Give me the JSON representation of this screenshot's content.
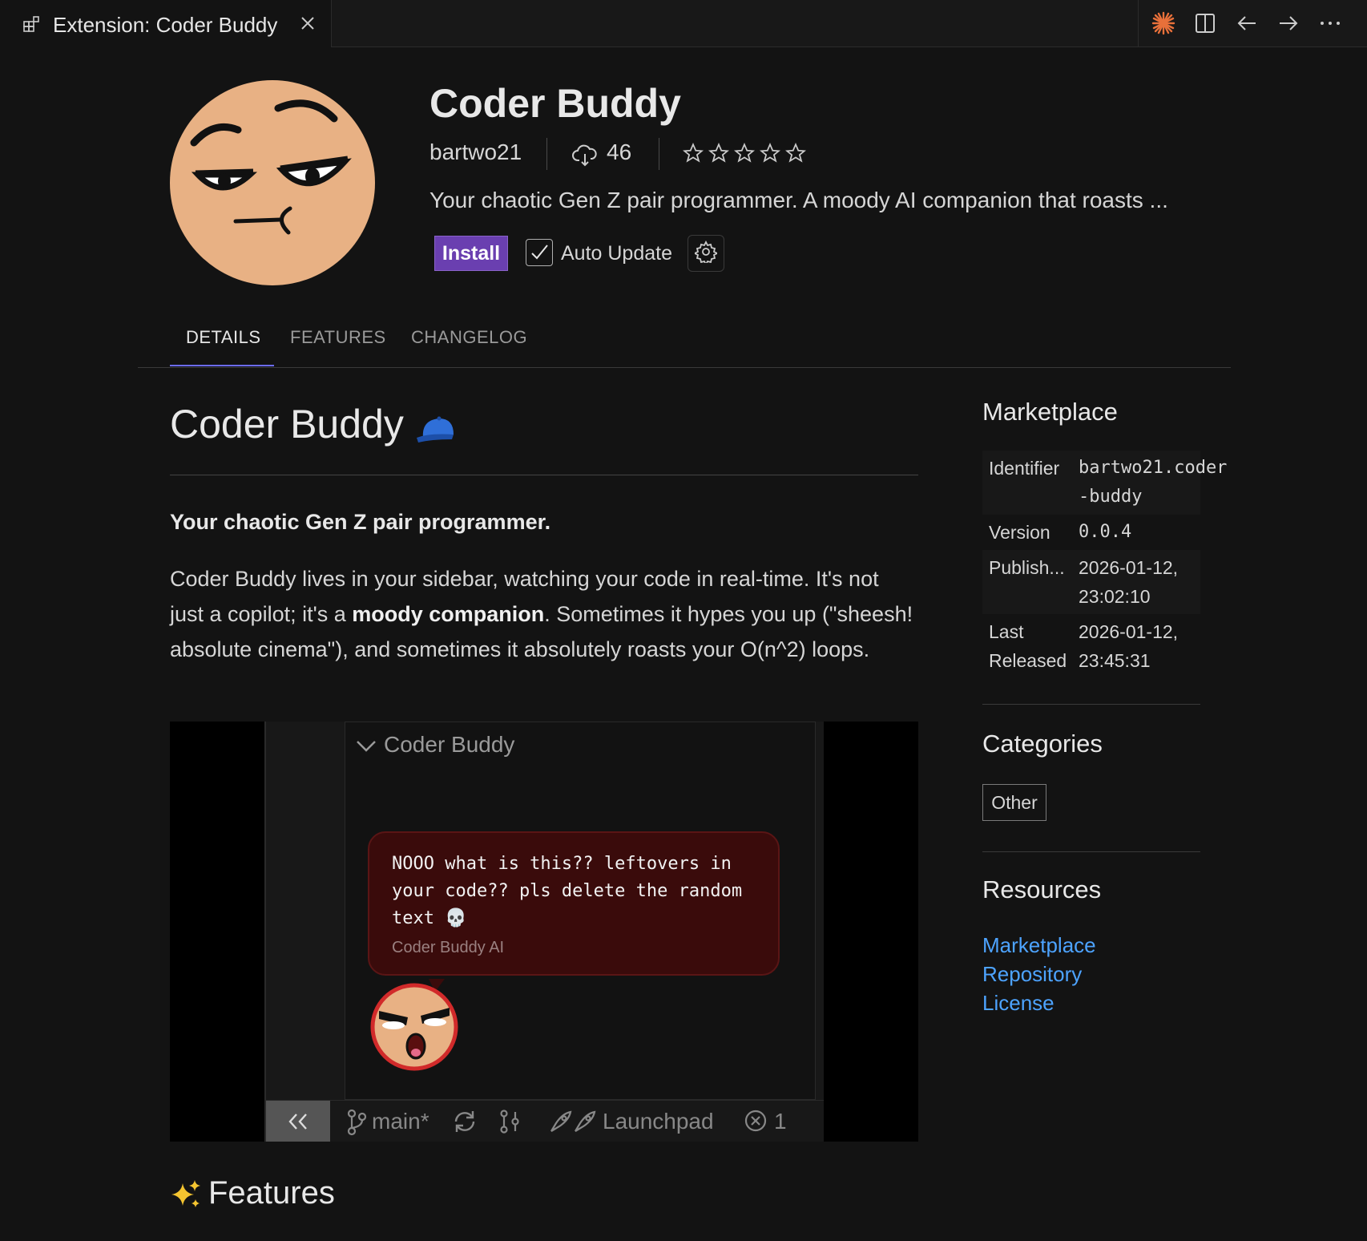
{
  "tab": {
    "title": "Extension: Coder Buddy",
    "icon": "extensions-icon"
  },
  "editor_actions": [
    "copilot-icon",
    "split-editor-icon",
    "go-back-icon",
    "go-forward-icon",
    "more-actions-icon"
  ],
  "header": {
    "name": "Coder Buddy",
    "publisher": "bartwo21",
    "downloads": "46",
    "rating_stars": 0,
    "short_description": "Your chaotic Gen Z pair programmer. A moody AI companion that roasts ...",
    "install_label": "Install",
    "auto_update_label": "Auto Update",
    "auto_update_checked": true
  },
  "nav_tabs": [
    {
      "label": "DETAILS",
      "active": true
    },
    {
      "label": "FEATURES",
      "active": false
    },
    {
      "label": "CHANGELOG",
      "active": false
    }
  ],
  "readme": {
    "heading": "Coder Buddy",
    "tagline": "Your chaotic Gen Z pair programmer.",
    "para_1": "Coder Buddy lives in your sidebar, watching your code in real-time. It's not just a copilot; it's a ",
    "para_bold": "moody companion",
    "para_2": ". Sometimes it hypes you up (\"sheesh! absolute cinema\"), and sometimes it absolutely roasts your O(n^2) loops.",
    "features_heading": "Features"
  },
  "screenshot": {
    "view_title": "Coder Buddy",
    "bubble_text": "NOOO what is this?? leftovers in your code?? pls delete the random text 💀",
    "bubble_author": "Coder Buddy AI",
    "status_branch": "main*",
    "status_launchpad": "Launchpad",
    "status_errors": "1"
  },
  "sidebar": {
    "marketplace_heading": "Marketplace",
    "identifier_label": "Identifier",
    "identifier_value": "bartwo21.coder-buddy",
    "version_label": "Version",
    "version_value": "0.0.4",
    "published_label": "Publish...",
    "published_value": "2026-01-12, 23:02:10",
    "released_label": "Last Released",
    "released_value": "2026-01-12, 23:45:31",
    "categories_heading": "Categories",
    "categories": [
      "Other"
    ],
    "resources_heading": "Resources",
    "resources": [
      "Marketplace",
      "Repository",
      "License"
    ]
  },
  "colors": {
    "install": "#6a3fb0",
    "link": "#4da3ff",
    "tab_underline": "#6c6cff",
    "face": "#e8b184",
    "bubble": "#3a0b0b"
  }
}
